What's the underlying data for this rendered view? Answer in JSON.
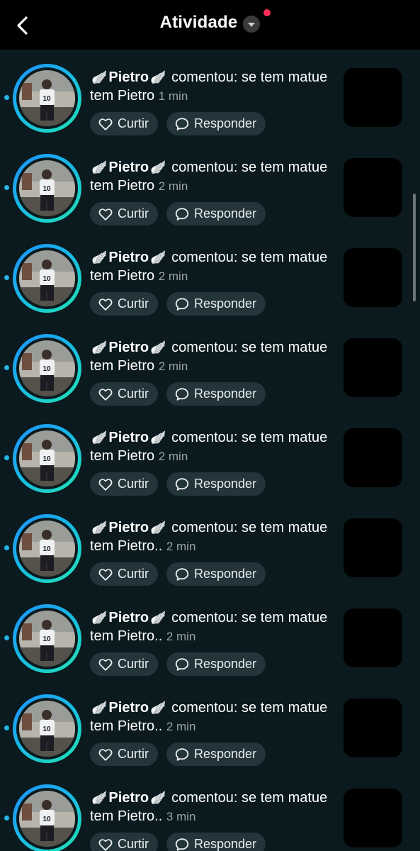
{
  "header": {
    "title": "Atividade"
  },
  "actions": {
    "like": "Curtir",
    "reply": "Responder"
  },
  "icons": {
    "back": "chevron-left-icon",
    "caret": "caret-down-icon",
    "like": "heart-icon",
    "reply": "speech-bubble-icon",
    "wing": "wing-icon"
  },
  "colors": {
    "background": "#0a1a1e",
    "header": "#000000",
    "pill": "#23353a",
    "unread": "#27b4e8",
    "notification": "#ff2d55"
  },
  "notifications": [
    {
      "user": "Pietro",
      "action": "comentou: se tem matue tem Pietro",
      "time": "1 min"
    },
    {
      "user": "Pietro",
      "action": "comentou: se tem matue tem Pietro",
      "time": "2 min"
    },
    {
      "user": "Pietro",
      "action": "comentou: se tem matue tem Pietro",
      "time": "2 min"
    },
    {
      "user": "Pietro",
      "action": "comentou: se tem matue tem Pietro",
      "time": "2 min"
    },
    {
      "user": "Pietro",
      "action": "comentou: se tem matue tem Pietro",
      "time": "2 min"
    },
    {
      "user": "Pietro",
      "action": "comentou: se tem matue tem Pietro..",
      "time": "2 min"
    },
    {
      "user": "Pietro",
      "action": "comentou: se tem matue tem Pietro..",
      "time": "2 min"
    },
    {
      "user": "Pietro",
      "action": "comentou: se tem matue tem Pietro..",
      "time": "2 min"
    },
    {
      "user": "Pietro",
      "action": "comentou: se tem matue tem Pietro..",
      "time": "3 min"
    }
  ]
}
